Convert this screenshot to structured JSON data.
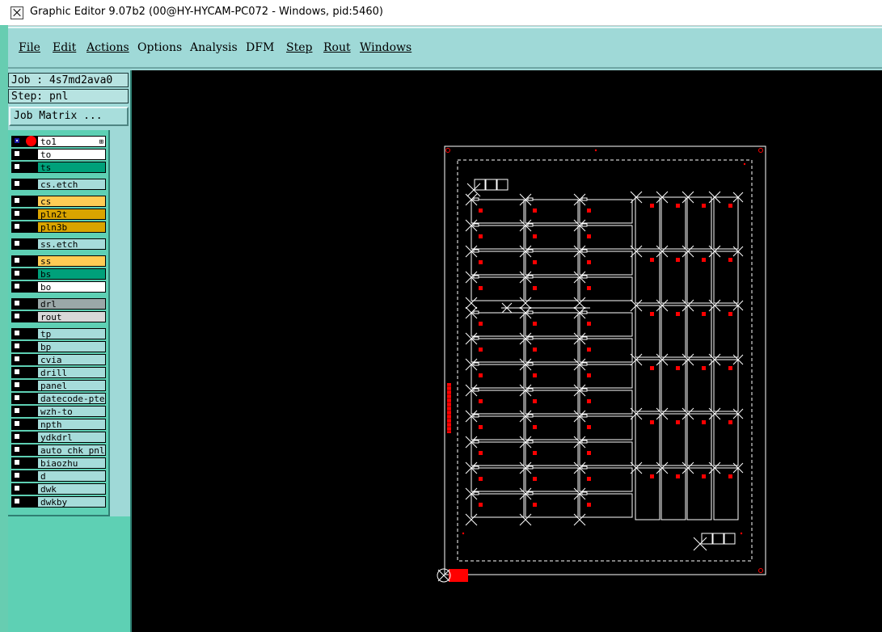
{
  "window": {
    "title": "Graphic Editor 9.07b2 (00@HY-HYCAM-PC072 - Windows, pid:5460)"
  },
  "menu": {
    "items": [
      {
        "label": "File",
        "underline": true
      },
      {
        "label": "Edit",
        "underline": true
      },
      {
        "label": "Actions",
        "underline": true
      },
      {
        "label": "Options",
        "underline": false
      },
      {
        "label": "Analysis",
        "underline": false
      },
      {
        "label": "DFM",
        "underline": false
      },
      {
        "label": "Step",
        "underline": true
      },
      {
        "label": "Rout",
        "underline": true
      },
      {
        "label": "Windows",
        "underline": true
      }
    ]
  },
  "panel": {
    "job_label": "Job : 4s7md2ava0",
    "step_label": "Step: pnl",
    "job_matrix_label": "Job Matrix ..."
  },
  "layers": [
    {
      "name": "to1",
      "color": "#ffffff",
      "selected": true,
      "active": true
    },
    {
      "name": "to",
      "color": "#ffffff"
    },
    {
      "name": "ts",
      "color": "#00a07a"
    },
    {
      "name": "cs.etch",
      "color": "#a6dcda"
    },
    {
      "name": "cs",
      "color": "#ffcc55"
    },
    {
      "name": "pln2t",
      "color": "#d9a400"
    },
    {
      "name": "pln3b",
      "color": "#d9a400"
    },
    {
      "name": "ss.etch",
      "color": "#a6dcda"
    },
    {
      "name": "ss",
      "color": "#ffcc55"
    },
    {
      "name": "bs",
      "color": "#00a07a"
    },
    {
      "name": "bo",
      "color": "#ffffff"
    },
    {
      "name": "drl",
      "color": "#9aa8a8"
    },
    {
      "name": "rout",
      "color": "#d8d8d8"
    },
    {
      "name": "tp",
      "color": "#a6dcda"
    },
    {
      "name": "bp",
      "color": "#a6dcda"
    },
    {
      "name": "cvia",
      "color": "#a6dcda"
    },
    {
      "name": "drill",
      "color": "#a6dcda"
    },
    {
      "name": "panel",
      "color": "#a6dcda"
    },
    {
      "name": "datecode-pte",
      "color": "#a6dcda"
    },
    {
      "name": "wzh-to",
      "color": "#a6dcda"
    },
    {
      "name": "npth",
      "color": "#a6dcda"
    },
    {
      "name": "ydkdrl",
      "color": "#a6dcda"
    },
    {
      "name": "auto_chk_pnl",
      "color": "#a6dcda"
    },
    {
      "name": "biaozhu",
      "color": "#a6dcda"
    },
    {
      "name": "d",
      "color": "#a6dcda"
    },
    {
      "name": "dwk",
      "color": "#a6dcda"
    },
    {
      "name": "dwkby",
      "color": "#a6dcda"
    }
  ],
  "colors": {
    "background": "#000000",
    "outline": "#ffffff",
    "pad": "#ff0000",
    "panel_bg": "#9fd9d7"
  }
}
